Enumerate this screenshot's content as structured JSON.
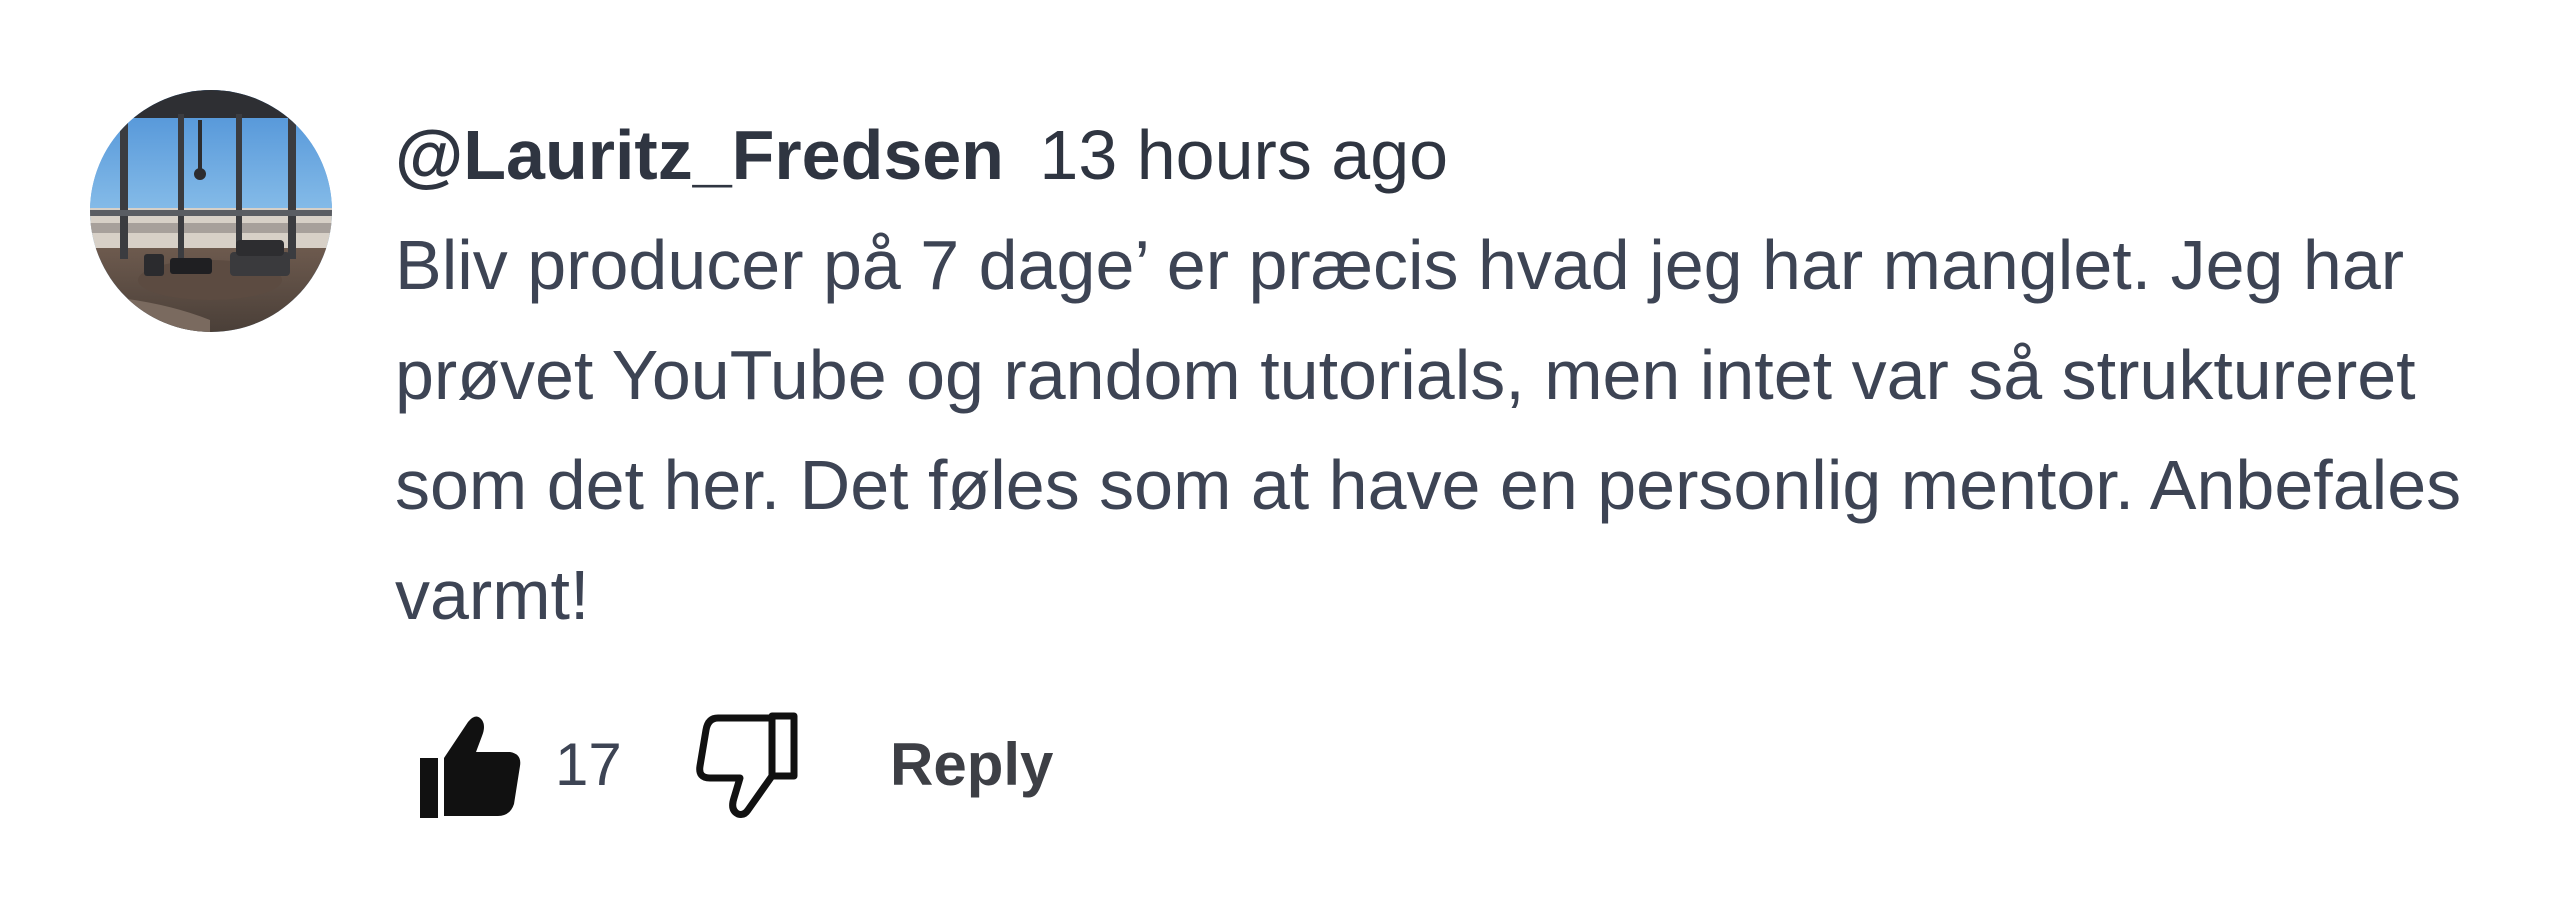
{
  "comment": {
    "author": "@Lauritz_Fredsen",
    "timestamp": "13 hours ago",
    "text": "Bliv producer på 7 dage’ er præcis hvad jeg har manglet. Jeg har prøvet YouTube og random tutorials, men intet var så struktureret som det her. Det føles som at have en personlig mentor. Anbefales varmt!",
    "likes": "17",
    "reply_label": "Reply"
  },
  "icons": {
    "avatar": "profile-photo",
    "like": "thumb-up-icon",
    "dislike": "thumb-down-icon"
  },
  "colors": {
    "text": "#3d4454",
    "author": "#2f3541",
    "icon": "#111111"
  }
}
